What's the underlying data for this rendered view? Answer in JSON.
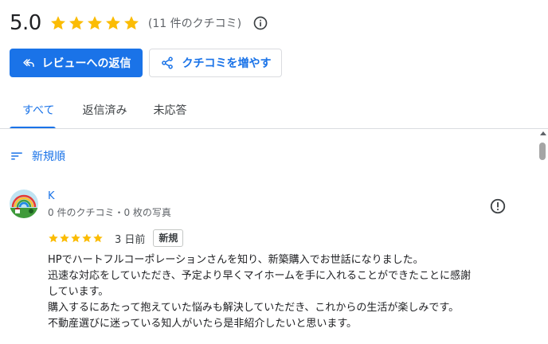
{
  "summary": {
    "score": "5.0",
    "stars": 5,
    "review_count": "(11 件のクチコミ)"
  },
  "actions": {
    "reply_label": "レビューへの返信",
    "get_more_label": "クチコミを増やす"
  },
  "tabs": {
    "all": "すべて",
    "replied": "返信済み",
    "unanswered": "未応答",
    "active": "all"
  },
  "sort": {
    "label": "新規順"
  },
  "review": {
    "name": "K",
    "meta": "0 件のクチコミ・0 枚の写真",
    "stars": 5,
    "date": "3 日前",
    "badge": "新規",
    "lines": [
      "HPでハートフルコーポレーションさんを知り、新築購入でお世話になりました。",
      "迅速な対応をしていただき、予定より早くマイホームを手に入れることができたことに感謝",
      "しています。",
      "購入するにあたって抱えていた悩みも解決していただき、これからの生活が楽しみです。",
      "不動産選びに迷っている知人がいたら是非紹介したいと思います。"
    ]
  },
  "colors": {
    "star": "#fbbc04",
    "accent": "#1a73e8"
  },
  "icons": {
    "info": "info-icon",
    "reply": "reply-arrow-icon",
    "share": "share-icon",
    "sort": "sort-lines-icon",
    "flag": "report-exclamation-icon"
  }
}
